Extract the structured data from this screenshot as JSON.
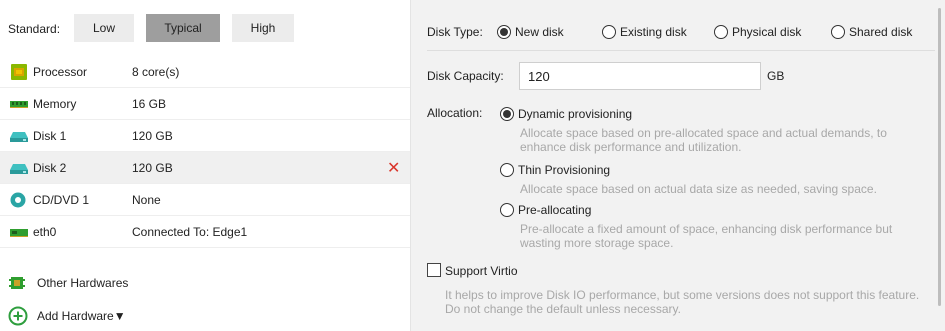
{
  "standard": {
    "label": "Standard:",
    "options": [
      "Low",
      "Typical",
      "High"
    ],
    "selected": "Typical"
  },
  "hardware": [
    {
      "name": "Processor",
      "value": "8 core(s)",
      "icon": "processor-icon"
    },
    {
      "name": "Memory",
      "value": "16 GB",
      "icon": "memory-icon"
    },
    {
      "name": "Disk 1",
      "value": "120 GB",
      "icon": "disk-icon"
    },
    {
      "name": "Disk 2",
      "value": "120 GB",
      "icon": "disk-icon",
      "selected": true,
      "deletable": true
    },
    {
      "name": "CD/DVD 1",
      "value": "None",
      "icon": "cd-dvd-icon"
    },
    {
      "name": "eth0",
      "value": "Connected To: Edge1",
      "icon": "network-card-icon"
    }
  ],
  "other_hardwares": "Other Hardwares",
  "add_hardware": "Add Hardware▼",
  "disk": {
    "type_label": "Disk Type:",
    "types": [
      "New disk",
      "Existing disk",
      "Physical disk",
      "Shared disk"
    ],
    "selected_type": "New disk",
    "capacity_label": "Disk Capacity:",
    "capacity_value": "120",
    "capacity_unit": "GB",
    "allocation_label": "Allocation:",
    "allocation_options": [
      {
        "label": "Dynamic provisioning",
        "selected": true,
        "desc": "Allocate space based on pre-allocated space and actual demands, to enhance disk performance and utilization."
      },
      {
        "label": "Thin Provisioning",
        "selected": false,
        "desc": "Allocate space based on actual data size as needed, saving space."
      },
      {
        "label": "Pre-allocating",
        "selected": false,
        "desc": "Pre-allocate a fixed amount of space, enhancing disk performance but wasting more storage space."
      }
    ],
    "support_virtio_label": "Support Virtio",
    "support_virtio_checked": false,
    "support_virtio_desc": "It helps to improve Disk IO performance, but some versions does not support this feature. Do not change the default unless necessary."
  },
  "colors": {
    "selected_button": "#9e9e9e",
    "delete": "#d9352b",
    "add_icon": "#2e9e3e",
    "processor_icon": "#8ab800",
    "memory_icon": "#2f9e2f",
    "disk_icon": "#2aa5a5",
    "cd_icon": "#2aa5a5"
  }
}
